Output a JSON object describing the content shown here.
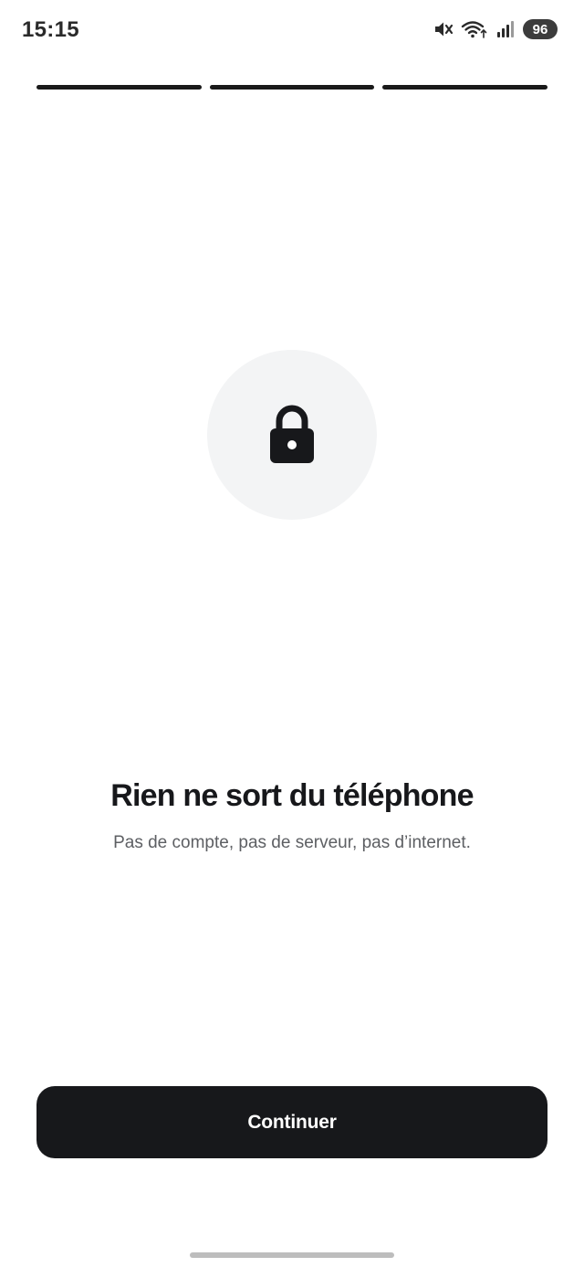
{
  "status_bar": {
    "time": "15:15",
    "battery_level": "96",
    "icons": [
      "mute-icon",
      "wifi-icon",
      "signal-icon",
      "battery-icon"
    ]
  },
  "onboarding": {
    "progress_steps_total": 3,
    "progress_steps_completed": 3,
    "illustration_icon": "lock-icon",
    "title": "Rien ne sort du téléphone",
    "subtitle": "Pas de compte, pas de serveur, pas d’internet.",
    "continue_label": "Continuer"
  },
  "colors": {
    "primary": "#17181b",
    "illustration_bg": "#f3f4f5",
    "subtitle_text": "#5d5f63"
  }
}
